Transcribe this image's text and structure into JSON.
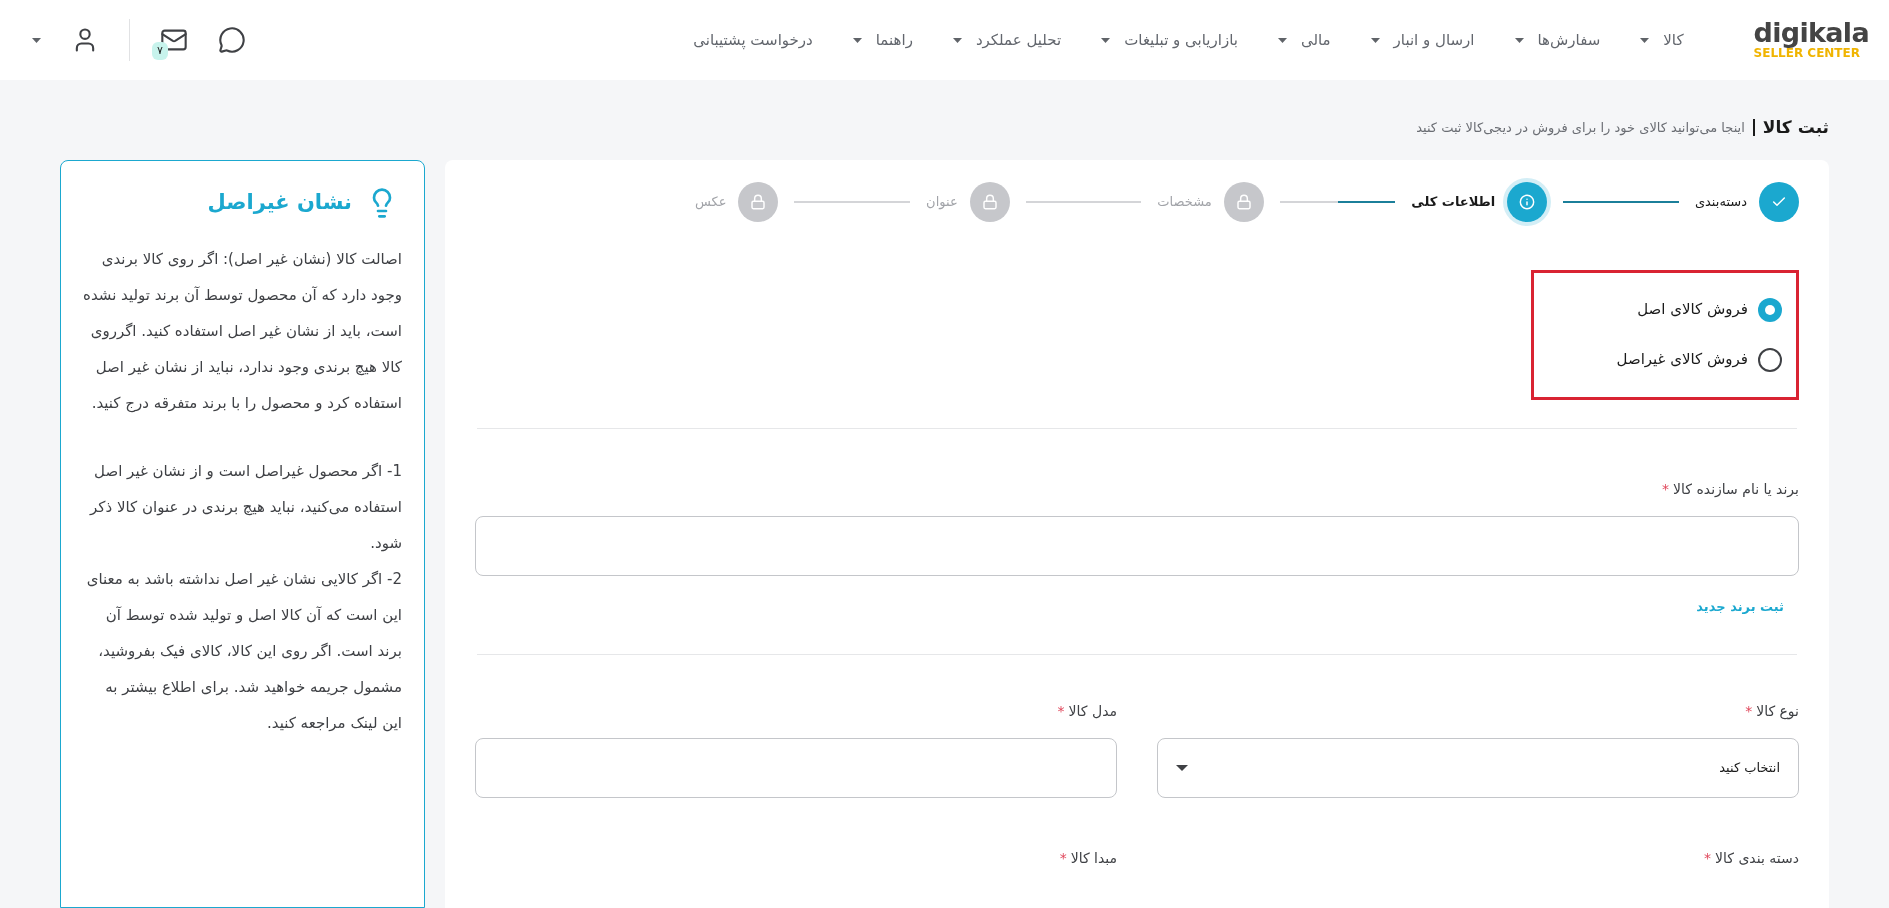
{
  "header": {
    "logo": {
      "name": "digikala",
      "subtitle": "SELLER CENTER"
    },
    "nav": [
      {
        "label": "کالا",
        "dropdown": true
      },
      {
        "label": "سفارش‌ها",
        "dropdown": true
      },
      {
        "label": "ارسال و انبار",
        "dropdown": true
      },
      {
        "label": "مالی",
        "dropdown": true
      },
      {
        "label": "بازاریابی و تبلیغات",
        "dropdown": true
      },
      {
        "label": "تحلیل عملکرد",
        "dropdown": true
      },
      {
        "label": "راهنما",
        "dropdown": true
      },
      {
        "label": "درخواست پشتیبانی",
        "dropdown": false
      }
    ],
    "mail_badge": "۷"
  },
  "page": {
    "title": "ثبت کالا",
    "subtitle": "اینجا می‌توانید کالای خود را برای فروش در دیجی‌کالا ثبت کنید"
  },
  "steps": [
    {
      "label": "دسته‌بندی",
      "completed": true,
      "selected": false
    },
    {
      "label": "اطلاعات کلی",
      "completed": false,
      "selected": true
    },
    {
      "label": "مشخصات",
      "completed": false,
      "selected": false
    },
    {
      "label": "عنوان",
      "completed": false,
      "selected": false
    },
    {
      "label": "عکس",
      "completed": false,
      "selected": false
    }
  ],
  "sale_type": [
    {
      "label": "فروش کالای اصل",
      "selected": true
    },
    {
      "label": "فروش کالای غیراصل",
      "selected": false
    }
  ],
  "brand": {
    "label": "برند یا نام سازنده کالا",
    "required_mark": "*",
    "link": "ثبت برند جدید"
  },
  "fields": [
    {
      "kind": "select",
      "label": "نوع کالا",
      "required_mark": "*",
      "value": "انتخاب کنید"
    },
    {
      "kind": "input",
      "label": "مدل کالا",
      "required_mark": "*"
    },
    {
      "kind": "label",
      "label": "دسته بندی کالا",
      "required_mark": "*"
    },
    {
      "kind": "label",
      "label": "مبدا کالا",
      "required_mark": "*"
    }
  ],
  "help": {
    "title": "نشان غیراصل",
    "paragraphs": [
      "اصالت کالا (نشان غیر اصل): اگر روی کالا برندی وجود دارد که آن محصول توسط آن برند تولید نشده است، باید از نشان غیر اصل استفاده کنید. اگرروی کالا هیچ برندی وجود ندارد، نباید از نشان غیر اصل استفاده کرد و محصول را با برند متفرقه درج کنید.",
      "1- اگر محصول غیراصل است و از نشان غیر اصل استفاده می‌کنید، نباید هیچ برندی در عنوان کالا ذکر شود.",
      "2- اگر کالایی نشان غیر اصل نداشته باشد به معنای این است که آن کالا اصل و تولید شده توسط آن برند است. اگر روی این کالا، کالای فیک بفروشید، مشمول جریمه خواهید شد. برای اطلاع بیشتر به این لینک مراجعه کنید."
    ]
  }
}
